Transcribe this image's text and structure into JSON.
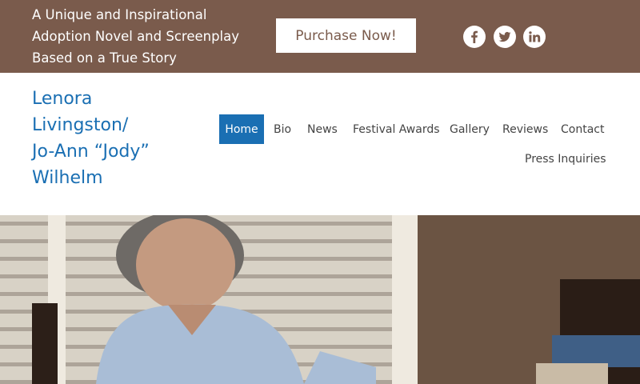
{
  "topbar": {
    "tagline_lines": [
      "A Unique and Inspirational",
      "Adoption Novel and Screenplay",
      "Based on a True Story"
    ],
    "purchase_label": "Purchase Now!",
    "social": [
      {
        "name": "facebook",
        "icon": "facebook-icon"
      },
      {
        "name": "twitter",
        "icon": "twitter-icon"
      },
      {
        "name": "linkedin",
        "icon": "linkedin-icon"
      }
    ],
    "background_color": "#7a5b4c"
  },
  "header": {
    "site_title_lines": [
      "Lenora",
      "Livingston/",
      "Jo-Ann “Jody”",
      "Wilhelm"
    ],
    "title_color": "#1a6fb3"
  },
  "nav": {
    "items": [
      {
        "label": "Home",
        "active": true
      },
      {
        "label": "Bio",
        "active": false
      },
      {
        "label": "News",
        "active": false
      },
      {
        "label": "Festival Awards",
        "active": false
      },
      {
        "label": "Gallery",
        "active": false
      },
      {
        "label": "Reviews",
        "active": false
      },
      {
        "label": "Contact",
        "active": false
      },
      {
        "label": "Press Inquiries",
        "active": false
      }
    ],
    "active_color": "#1a6fb3"
  },
  "hero": {
    "image": "photo of a gray-haired woman in a light blue shirt writing at a table beside window blinds"
  }
}
